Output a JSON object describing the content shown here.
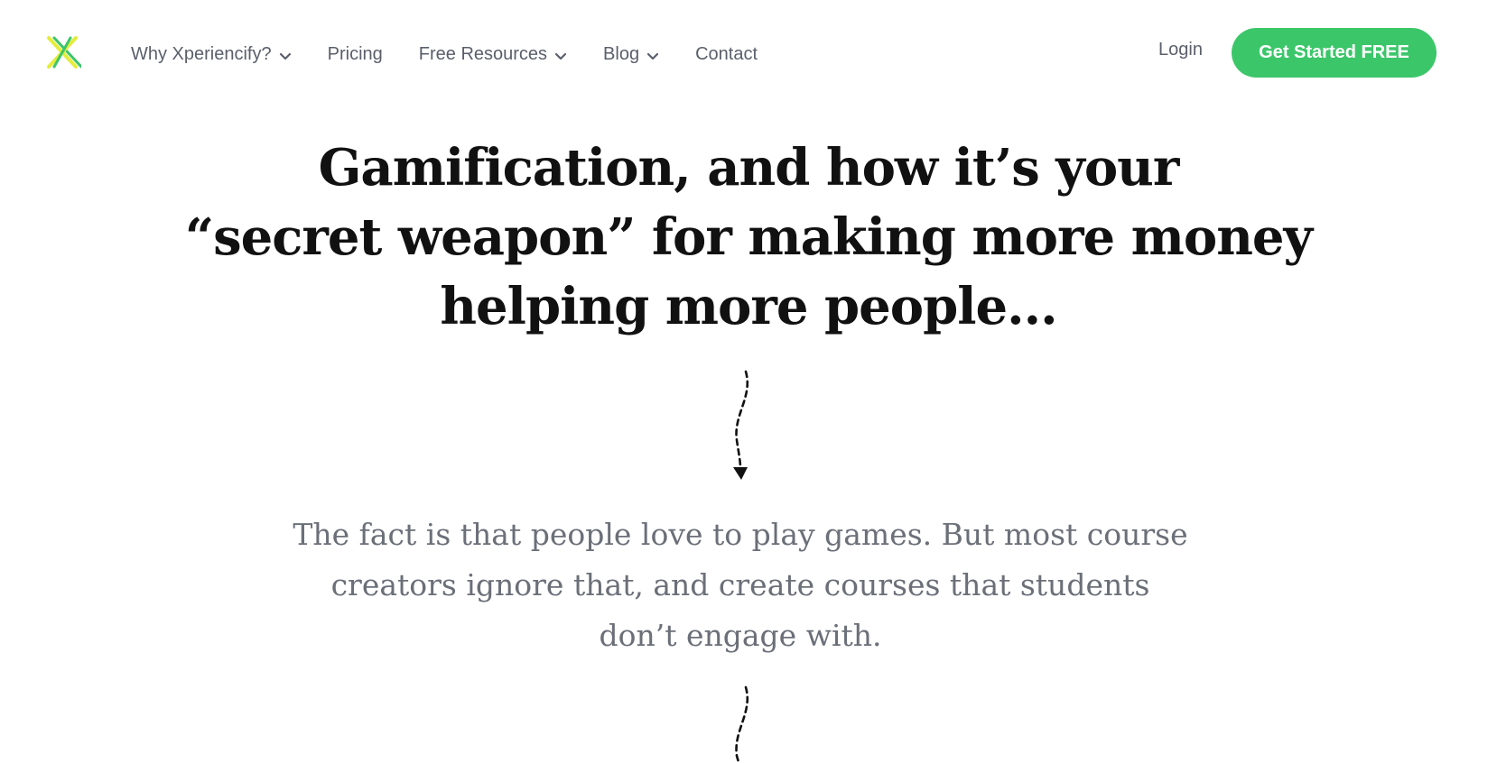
{
  "brand": {
    "logo_icon": "xperiencify-x-logo-icon",
    "colors": {
      "logo_yellow": "#e4ec3c",
      "logo_green": "#3cc66a",
      "cta_green": "#3cc66a",
      "highlight_yellow": "#fce67a",
      "nav_text": "#5a5f6a",
      "heading_text": "#111111",
      "body_text": "#6b6f78"
    }
  },
  "nav": {
    "items": [
      {
        "label": "Why Xperiencify?",
        "dropdown": true
      },
      {
        "label": "Pricing",
        "dropdown": false
      },
      {
        "label": "Free Resources",
        "dropdown": true
      },
      {
        "label": "Blog",
        "dropdown": true
      },
      {
        "label": "Contact",
        "dropdown": false
      }
    ],
    "login_label": "Login",
    "cta_label": "Get Started FREE"
  },
  "hero": {
    "headline_highlight": "Gamification",
    "headline_line1_rest": ", and how it’s your",
    "headline_line2": "“secret weapon” for making more money",
    "headline_line3": "helping more people...",
    "intro": "The fact is that people love to play games. But most course creators ignore that, and create courses that students don’t engage with."
  }
}
